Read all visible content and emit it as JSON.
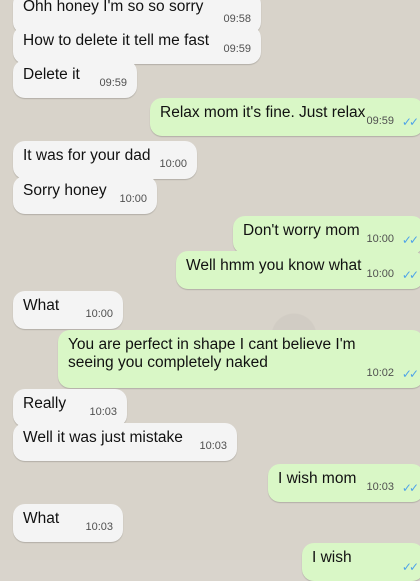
{
  "messages": [
    {
      "side": "in",
      "text": "Ohh honey I'm so so sorry",
      "time": "09:58"
    },
    {
      "side": "in",
      "text": "How to delete it tell me fast",
      "time": "09:59"
    },
    {
      "side": "in",
      "text": "Delete it",
      "time": "09:59"
    },
    {
      "side": "out",
      "text": "Relax mom it's fine. Just relax",
      "time": "09:59"
    },
    {
      "side": "in",
      "text": "It was for your dad",
      "time": "10:00"
    },
    {
      "side": "in",
      "text": "Sorry honey",
      "time": "10:00"
    },
    {
      "side": "out",
      "text": "Don't worry mom",
      "time": "10:00"
    },
    {
      "side": "out",
      "text": "Well hmm you know what",
      "time": "10:00"
    },
    {
      "side": "in",
      "text": "What",
      "time": "10:00"
    },
    {
      "side": "out",
      "text": "You are perfect in shape I cant believe I'm seeing you completely naked",
      "time": "10:02"
    },
    {
      "side": "in",
      "text": "Really",
      "time": "10:03"
    },
    {
      "side": "in",
      "text": "Well it was just mistake",
      "time": "10:03"
    },
    {
      "side": "out",
      "text": "I wish mom",
      "time": "10:03"
    },
    {
      "side": "in",
      "text": "What",
      "time": "10:03"
    },
    {
      "side": "out",
      "text": "I wish",
      "time": ""
    }
  ],
  "read_receipt_icon": "double-check-icon",
  "colors": {
    "incoming": "#f4f4f4",
    "outgoing": "#d9f7c6",
    "tick": "#4fa3e8"
  }
}
